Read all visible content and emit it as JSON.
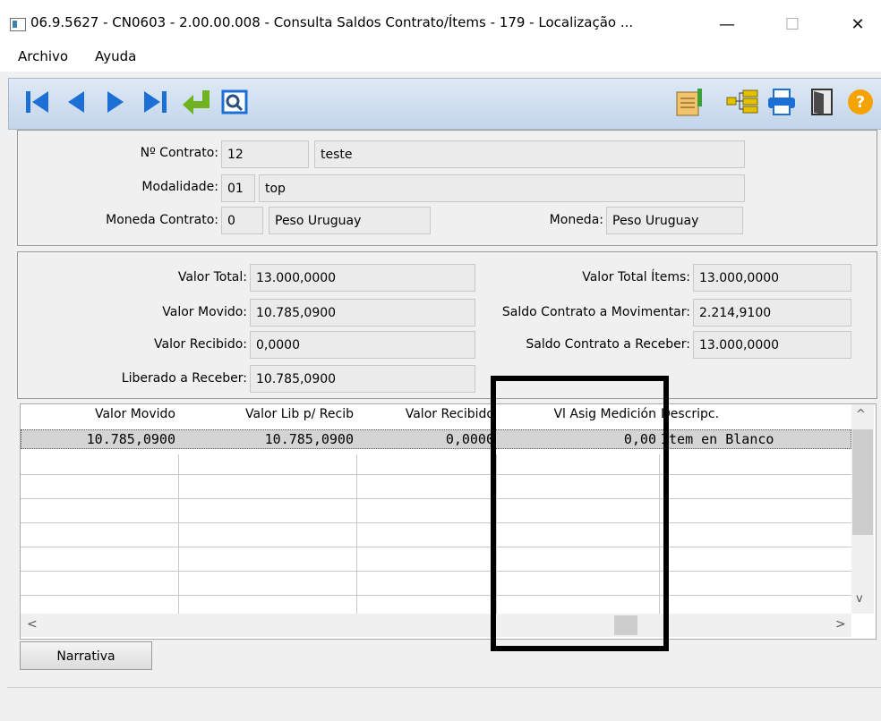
{
  "window": {
    "title": "06.9.5627 - CN0603 - 2.00.00.008 - Consulta Saldos Contrato/Ítems - 179 - Localização ...",
    "minimize": "—",
    "maximize": "☐",
    "close": "✕"
  },
  "menu": {
    "items": [
      "Archivo",
      "Ayuda"
    ]
  },
  "toolbar": {
    "left_icons": [
      "first-record-icon",
      "previous-record-icon",
      "next-record-icon",
      "last-record-icon",
      "go-to-icon",
      "search-icon"
    ],
    "right_icons": [
      "edit-document-icon",
      "tree-view-icon",
      "print-icon",
      "exit-door-icon",
      "help-icon"
    ],
    "accent_blue": "#1c6fd4",
    "accent_green": "#6fb320",
    "help_orange": "#f5a300"
  },
  "contract": {
    "contrato_label": "Nº Contrato:",
    "contrato_code": "12",
    "contrato_desc": "teste",
    "modalidade_label": "Modalidade:",
    "modalidade_code": "01",
    "modalidade_desc": "top",
    "moneda_contrato_label": "Moneda Contrato:",
    "moneda_contrato_code": "0",
    "moneda_contrato_desc": "Peso Uruguay",
    "moneda_label": "Moneda:",
    "moneda_value": "Peso Uruguay"
  },
  "totals": {
    "valor_total_label": "Valor Total:",
    "valor_total": "13.000,0000",
    "valor_movido_label": "Valor Movido:",
    "valor_movido": "10.785,0900",
    "valor_recibido_label": "Valor Recibido:",
    "valor_recibido": "0,0000",
    "liberado_label": "Liberado a Receber:",
    "liberado": "10.785,0900",
    "valor_total_items_label": "Valor Total Ítems:",
    "valor_total_items": "13.000,0000",
    "saldo_mov_label": "Saldo Contrato a Movimentar:",
    "saldo_mov": "2.214,9100",
    "saldo_rec_label": "Saldo Contrato a Receber:",
    "saldo_rec": "13.000,0000"
  },
  "grid": {
    "columns": [
      "Valor Movido",
      "Valor Lib p/ Recib",
      "Valor Recibido",
      "Vl Asig Medición",
      "Descripc."
    ],
    "rows": [
      [
        "10.785,0900",
        "10.785,0900",
        "0,0000",
        "0,00",
        "Item en Blanco"
      ]
    ],
    "scroll_up": "^",
    "scroll_down": "v",
    "scroll_left": "<",
    "scroll_right": ">"
  },
  "buttons": {
    "narrativa": "Narrativa"
  }
}
